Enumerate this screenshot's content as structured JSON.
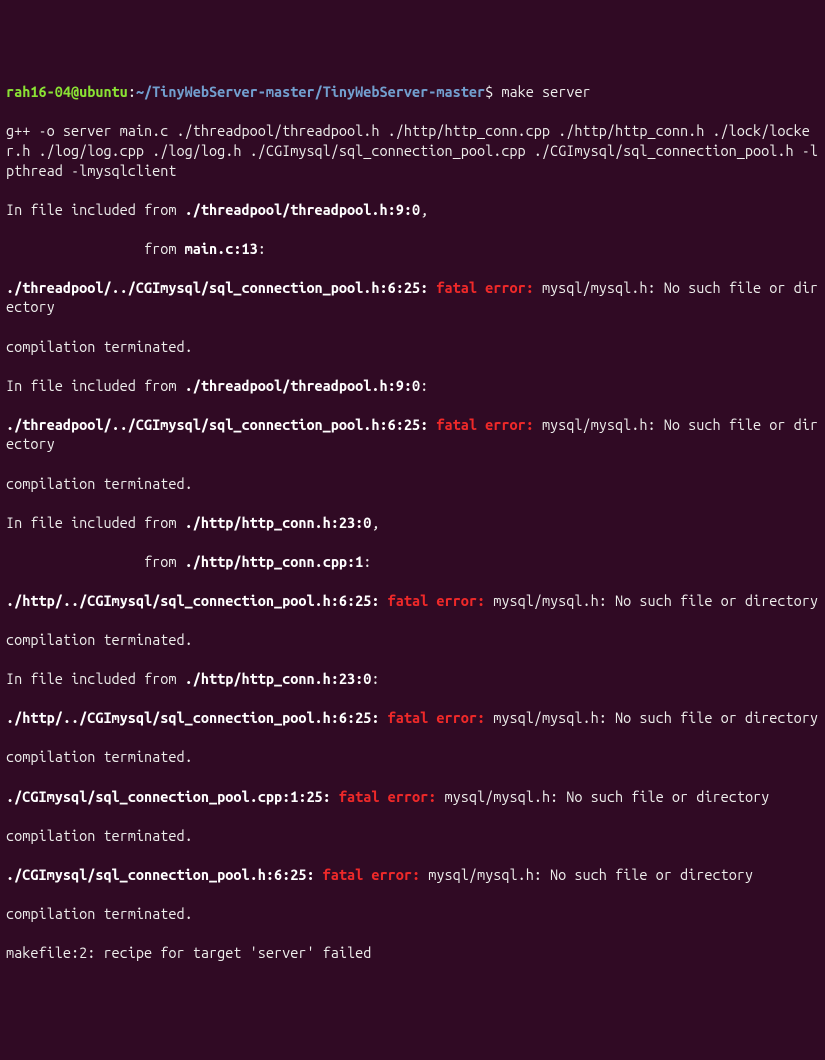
{
  "prompt": {
    "user": "rah16-04@ubuntu",
    "sep1": ":",
    "path": "~/TinyWebServer-master/TinyWebServer-master",
    "sep2": "$ ",
    "command": "make server"
  },
  "lines": {
    "l01": "g++ -o server main.c ./threadpool/threadpool.h ./http/http_conn.cpp ./http/http_conn.h ./lock/locker.h ./log/log.cpp ./log/log.h ./CGImysql/sql_connection_pool.cpp ./CGImysql/sql_connection_pool.h -lpthread -lmysqlclient",
    "l02a": "In file included from ",
    "l02b": "./threadpool/threadpool.h:9:0",
    "l02c": ",",
    "l03a": "                 from ",
    "l03b": "main.c:13",
    "l03c": ":",
    "l04a": "./threadpool/../CGImysql/sql_connection_pool.h:6:25:",
    "l04b": " fatal error: ",
    "l04c": "mysql/mysql.h: No such file or directory",
    "l05": "compilation terminated.",
    "l06a": "In file included from ",
    "l06b": "./threadpool/threadpool.h:9:0",
    "l06c": ":",
    "l07a": "./threadpool/../CGImysql/sql_connection_pool.h:6:25:",
    "l07b": " fatal error: ",
    "l07c": "mysql/mysql.h: No such file or directory",
    "l08": "compilation terminated.",
    "l09a": "In file included from ",
    "l09b": "./http/http_conn.h:23:0",
    "l09c": ",",
    "l10a": "                 from ",
    "l10b": "./http/http_conn.cpp:1",
    "l10c": ":",
    "l11a": "./http/../CGImysql/sql_connection_pool.h:6:25:",
    "l11b": " fatal error: ",
    "l11c": "mysql/mysql.h: No such file or directory",
    "l12": "compilation terminated.",
    "l13a": "In file included from ",
    "l13b": "./http/http_conn.h:23:0",
    "l13c": ":",
    "l14a": "./http/../CGImysql/sql_connection_pool.h:6:25:",
    "l14b": " fatal error: ",
    "l14c": "mysql/mysql.h: No such file or directory",
    "l15": "compilation terminated.",
    "l16a": "./CGImysql/sql_connection_pool.cpp:1:25:",
    "l16b": " fatal error: ",
    "l16c": "mysql/mysql.h: No such file or directory",
    "l17": "compilation terminated.",
    "l18a": "./CGImysql/sql_connection_pool.h:6:25:",
    "l18b": " fatal error: ",
    "l18c": "mysql/mysql.h: No such file or directory",
    "l19": "compilation terminated.",
    "l20": "makefile:2: recipe for target 'server' failed"
  }
}
